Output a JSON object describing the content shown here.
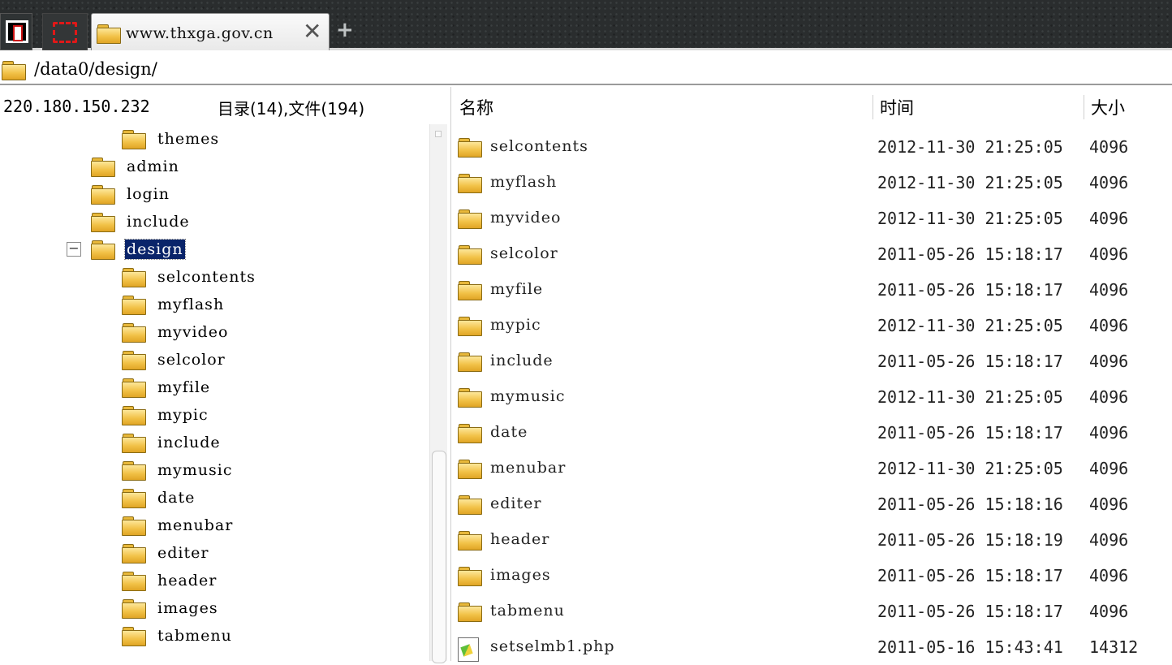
{
  "tabbar": {
    "tab_title": "www.thxga.gov.cn",
    "close_glyph": "✕",
    "new_tab_glyph": "+",
    "icons": [
      "app-window-icon",
      "red-dashed-box-icon",
      "folder-icon",
      "close-icon",
      "plus-icon"
    ]
  },
  "address": {
    "path": "/data0/design/"
  },
  "left_panel": {
    "ip": "220.180.150.232",
    "counts": "目录(14),文件(194)",
    "expander_glyph": "−",
    "tree": [
      {
        "label": "themes",
        "level": 2
      },
      {
        "label": "admin",
        "level": 1
      },
      {
        "label": "login",
        "level": 1
      },
      {
        "label": "include",
        "level": 1
      },
      {
        "label": "design",
        "level": 1,
        "selected": true,
        "expanded": true
      },
      {
        "label": "selcontents",
        "level": 2
      },
      {
        "label": "myflash",
        "level": 2
      },
      {
        "label": "myvideo",
        "level": 2
      },
      {
        "label": "selcolor",
        "level": 2
      },
      {
        "label": "myfile",
        "level": 2
      },
      {
        "label": "mypic",
        "level": 2
      },
      {
        "label": "include",
        "level": 2
      },
      {
        "label": "mymusic",
        "level": 2
      },
      {
        "label": "date",
        "level": 2
      },
      {
        "label": "menubar",
        "level": 2
      },
      {
        "label": "editer",
        "level": 2
      },
      {
        "label": "header",
        "level": 2
      },
      {
        "label": "images",
        "level": 2
      },
      {
        "label": "tabmenu",
        "level": 2
      }
    ]
  },
  "file_list": {
    "columns": {
      "name": "名称",
      "time": "时间",
      "size": "大小"
    },
    "rows": [
      {
        "name": "selcontents",
        "time": "2012-11-30 21:25:05",
        "size": "4096",
        "type": "folder"
      },
      {
        "name": "myflash",
        "time": "2012-11-30 21:25:05",
        "size": "4096",
        "type": "folder"
      },
      {
        "name": "myvideo",
        "time": "2012-11-30 21:25:05",
        "size": "4096",
        "type": "folder"
      },
      {
        "name": "selcolor",
        "time": "2011-05-26 15:18:17",
        "size": "4096",
        "type": "folder"
      },
      {
        "name": "myfile",
        "time": "2011-05-26 15:18:17",
        "size": "4096",
        "type": "folder"
      },
      {
        "name": "mypic",
        "time": "2012-11-30 21:25:05",
        "size": "4096",
        "type": "folder"
      },
      {
        "name": "include",
        "time": "2011-05-26 15:18:17",
        "size": "4096",
        "type": "folder"
      },
      {
        "name": "mymusic",
        "time": "2012-11-30 21:25:05",
        "size": "4096",
        "type": "folder"
      },
      {
        "name": "date",
        "time": "2011-05-26 15:18:17",
        "size": "4096",
        "type": "folder"
      },
      {
        "name": "menubar",
        "time": "2012-11-30 21:25:05",
        "size": "4096",
        "type": "folder"
      },
      {
        "name": "editer",
        "time": "2011-05-26 15:18:16",
        "size": "4096",
        "type": "folder"
      },
      {
        "name": "header",
        "time": "2011-05-26 15:18:19",
        "size": "4096",
        "type": "folder"
      },
      {
        "name": "images",
        "time": "2011-05-26 15:18:17",
        "size": "4096",
        "type": "folder"
      },
      {
        "name": "tabmenu",
        "time": "2011-05-26 15:18:17",
        "size": "4096",
        "type": "folder"
      },
      {
        "name": "setselmb1.php",
        "time": "2011-05-16 15:43:41",
        "size": "14312",
        "type": "file"
      }
    ]
  }
}
